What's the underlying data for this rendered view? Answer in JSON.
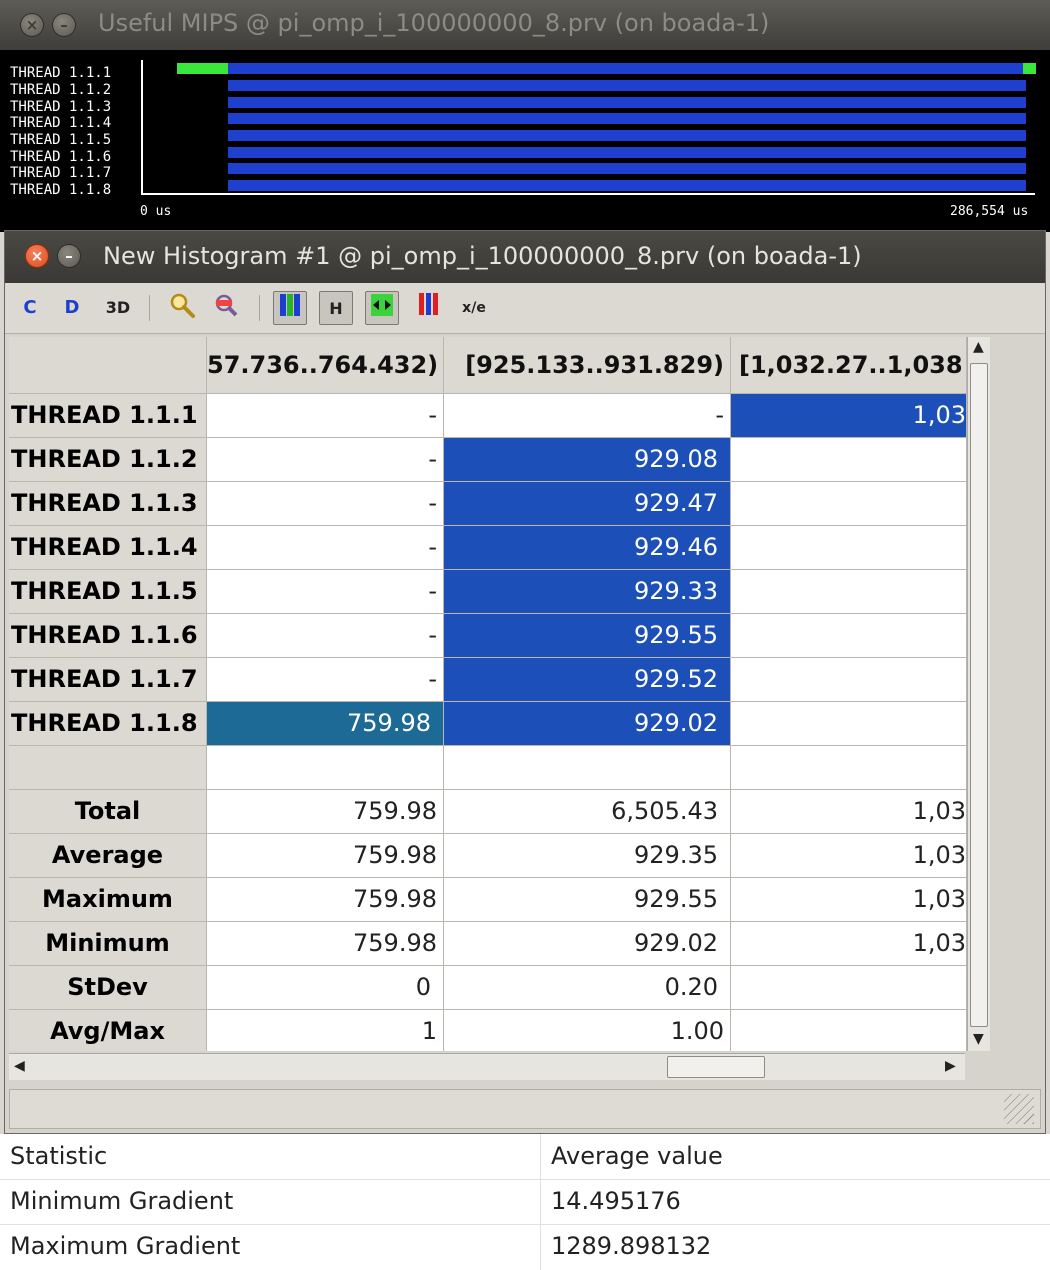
{
  "timeline_window": {
    "title": "Useful MIPS @ pi_omp_i_100000000_8.prv (on boada-1)",
    "threads": [
      "THREAD 1.1.1",
      "THREAD 1.1.2",
      "THREAD 1.1.3",
      "THREAD 1.1.4",
      "THREAD 1.1.5",
      "THREAD 1.1.6",
      "THREAD 1.1.7",
      "THREAD 1.1.8"
    ],
    "time_start": "0 us",
    "time_end": "286,554 us",
    "colors": {
      "green": "#39e83a",
      "blue": "#1f3fcf"
    }
  },
  "histogram_window": {
    "title": "New Histogram #1 @ pi_omp_i_100000000_8.prv (on boada-1)",
    "toolbar": {
      "b1": "C",
      "b2": "D",
      "b3": "3D",
      "b4": "zoom-icon",
      "b5": "open-control-icon",
      "b6": "gradient-color-icon",
      "b7": "H",
      "b8": "fit-columns-icon",
      "b9": "color-bars-icon",
      "b10": "x/e"
    },
    "columns": [
      "57.736..764.432)",
      "[925.133..931.829)",
      "[1,032.27..1,038"
    ],
    "rows": [
      {
        "label": "THREAD 1.1.1",
        "c1": "-",
        "c2": "-",
        "c3": "1,03"
      },
      {
        "label": "THREAD 1.1.2",
        "c1": "-",
        "c2": "929.08",
        "c3": ""
      },
      {
        "label": "THREAD 1.1.3",
        "c1": "-",
        "c2": "929.47",
        "c3": ""
      },
      {
        "label": "THREAD 1.1.4",
        "c1": "-",
        "c2": "929.46",
        "c3": ""
      },
      {
        "label": "THREAD 1.1.5",
        "c1": "-",
        "c2": "929.33",
        "c3": ""
      },
      {
        "label": "THREAD 1.1.6",
        "c1": "-",
        "c2": "929.55",
        "c3": ""
      },
      {
        "label": "THREAD 1.1.7",
        "c1": "-",
        "c2": "929.52",
        "c3": ""
      },
      {
        "label": "THREAD 1.1.8",
        "c1": "759.98",
        "c2": "929.02",
        "c3": ""
      }
    ],
    "stats": [
      {
        "label": "Total",
        "c1": "759.98",
        "c2": "6,505.43",
        "c3": "1,03"
      },
      {
        "label": "Average",
        "c1": "759.98",
        "c2": "929.35",
        "c3": "1,03"
      },
      {
        "label": "Maximum",
        "c1": "759.98",
        "c2": "929.55",
        "c3": "1,03"
      },
      {
        "label": "Minimum",
        "c1": "759.98",
        "c2": "929.02",
        "c3": "1,03"
      },
      {
        "label": "StDev",
        "c1": "0",
        "c2": "0.20",
        "c3": ""
      },
      {
        "label": "Avg/Max",
        "c1": "1",
        "c2": "1.00",
        "c3": ""
      }
    ],
    "colors": {
      "cell_blue": "#1c4fb8",
      "cell_teal": "#1d6a96"
    }
  },
  "stats_table": {
    "headers": [
      "Statistic",
      "Average value"
    ],
    "rows": [
      {
        "statistic": "Minimum Gradient",
        "value": "14.495176"
      },
      {
        "statistic": "Maximum Gradient",
        "value": "1289.898132"
      }
    ]
  }
}
